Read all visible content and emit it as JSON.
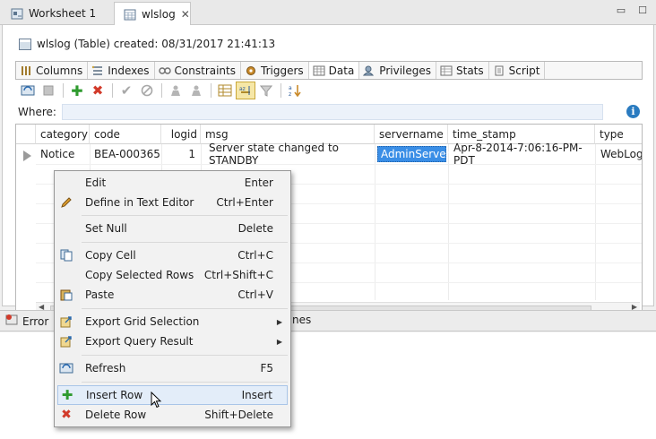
{
  "window": {
    "tabs": [
      {
        "label": "Worksheet 1",
        "icon": "worksheet-icon"
      },
      {
        "label": "wlslog",
        "icon": "table-icon",
        "active": true
      }
    ]
  },
  "table": {
    "title": "wlslog (Table) created: 08/31/2017 21:41:13"
  },
  "subtabs": [
    {
      "label": "Columns",
      "icon": "columns-icon"
    },
    {
      "label": "Indexes",
      "icon": "indexes-icon"
    },
    {
      "label": "Constraints",
      "icon": "constraints-icon"
    },
    {
      "label": "Triggers",
      "icon": "triggers-icon"
    },
    {
      "label": "Data",
      "icon": "data-icon",
      "active": true
    },
    {
      "label": "Privileges",
      "icon": "privileges-icon"
    },
    {
      "label": "Stats",
      "icon": "stats-icon"
    },
    {
      "label": "Script",
      "icon": "script-icon"
    }
  ],
  "where": {
    "label": "Where:",
    "value": ""
  },
  "grid": {
    "columns": [
      "category",
      "code",
      "logid",
      "msg",
      "servername",
      "time_stamp",
      "type"
    ],
    "rows": [
      [
        "Notice",
        "BEA-000365",
        "1",
        "Server state changed to STANDBY",
        "AdminServer",
        "Apr-8-2014-7:06:16-PM-PDT",
        "WebLog"
      ]
    ],
    "selected_cell": "AdminServer"
  },
  "lower_panel": {
    "tab1": "Error",
    "tab2_suffix": "nes"
  },
  "context_menu": {
    "items": [
      {
        "label": "Edit",
        "shortcut": "Enter",
        "icon": ""
      },
      {
        "label": "Define in Text Editor",
        "shortcut": "Ctrl+Enter",
        "icon": "pencil-icon"
      },
      {
        "label": "Set Null",
        "shortcut": "Delete",
        "icon": ""
      },
      {
        "label": "Copy Cell",
        "shortcut": "Ctrl+C",
        "icon": "copy-icon"
      },
      {
        "label": "Copy Selected Rows",
        "shortcut": "Ctrl+Shift+C",
        "icon": ""
      },
      {
        "label": "Paste",
        "shortcut": "Ctrl+V",
        "icon": "paste-icon"
      },
      {
        "label": "Export Grid Selection",
        "shortcut": "",
        "icon": "export-icon",
        "submenu": true
      },
      {
        "label": "Export Query Result",
        "shortcut": "",
        "icon": "export-icon",
        "submenu": true
      },
      {
        "label": "Refresh",
        "shortcut": "F5",
        "icon": "refresh-icon"
      },
      {
        "label": "Insert Row",
        "shortcut": "Insert",
        "icon": "plus-icon",
        "highlighted": true
      },
      {
        "label": "Delete Row",
        "shortcut": "Shift+Delete",
        "icon": "red-x-icon"
      }
    ]
  },
  "colors": {
    "selected_cell_bg": "#3a8ee6",
    "menu_hover_bg": "#e3edf9",
    "insert_green": "#2e9a2e",
    "delete_red": "#d23a2a",
    "info_blue": "#2a7bc0"
  }
}
